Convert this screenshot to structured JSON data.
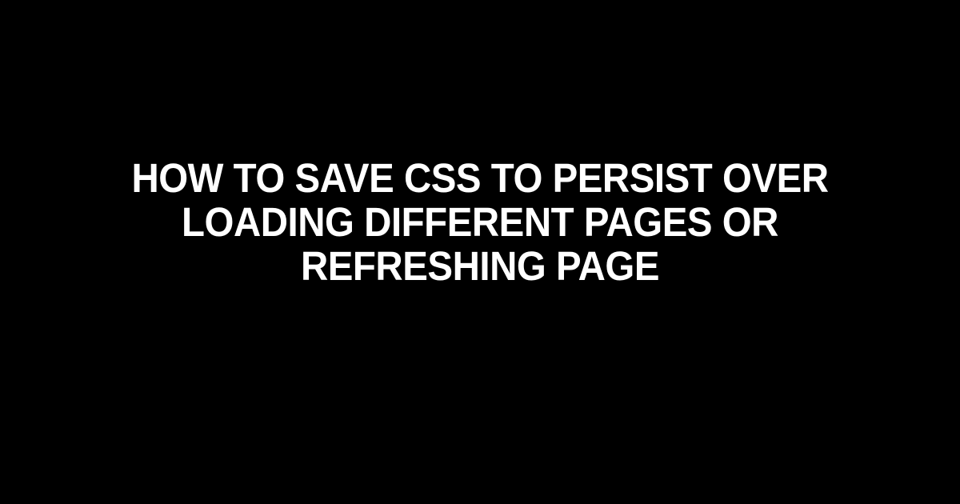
{
  "title": "How to Save CSS to Persist Over Loading Different Pages or Refreshing Page"
}
